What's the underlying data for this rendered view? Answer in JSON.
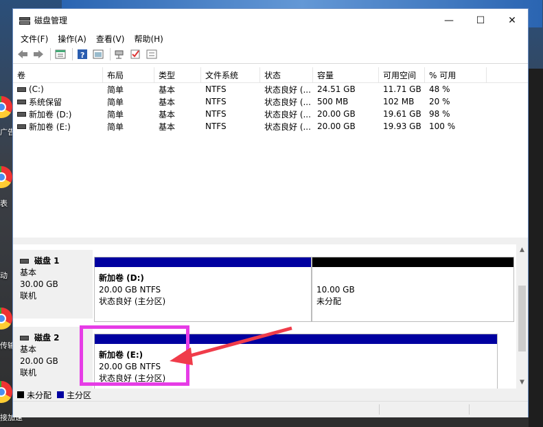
{
  "window": {
    "title": "磁盘管理",
    "controls": [
      "—",
      "☐",
      "✕"
    ]
  },
  "menu": [
    "文件(F)",
    "操作(A)",
    "查看(V)",
    "帮助(H)"
  ],
  "toolbar": [
    "back-icon",
    "forward-icon",
    "properties-icon",
    "help-icon",
    "view-icon",
    "connect-icon",
    "check-icon",
    "list-icon"
  ],
  "volumes": {
    "headers": [
      "卷",
      "布局",
      "类型",
      "文件系统",
      "状态",
      "容量",
      "可用空间",
      "% 可用"
    ],
    "rows": [
      [
        "(C:)",
        "简单",
        "基本",
        "NTFS",
        "状态良好 (...",
        "24.51 GB",
        "11.71 GB",
        "48 %"
      ],
      [
        "系统保留",
        "简单",
        "基本",
        "NTFS",
        "状态良好 (...",
        "500 MB",
        "102 MB",
        "20 %"
      ],
      [
        "新加卷 (D:)",
        "简单",
        "基本",
        "NTFS",
        "状态良好 (...",
        "20.00 GB",
        "19.61 GB",
        "98 %"
      ],
      [
        "新加卷 (E:)",
        "简单",
        "基本",
        "NTFS",
        "状态良好 (...",
        "20.00 GB",
        "19.93 GB",
        "100 %"
      ]
    ]
  },
  "disks": [
    {
      "name": "磁盘 1",
      "type": "基本",
      "size": "30.00 GB",
      "state": "联机",
      "partitions": [
        {
          "title": "新加卷 (D:)",
          "line1": "20.00 GB NTFS",
          "line2": "状态良好 (主分区)",
          "color": "#0000a0"
        },
        {
          "title": "",
          "line1": "10.00 GB",
          "line2": "未分配",
          "color": "#000000"
        }
      ]
    },
    {
      "name": "磁盘 2",
      "type": "基本",
      "size": "20.00 GB",
      "state": "联机",
      "partitions": [
        {
          "title": "新加卷 (E:)",
          "line1": "20.00 GB NTFS",
          "line2": "状态良好 (主分区)",
          "color": "#0000a0"
        }
      ]
    }
  ],
  "legend": [
    {
      "label": "未分配",
      "color": "#000000"
    },
    {
      "label": "主分区",
      "color": "#0000a0"
    }
  ],
  "desktop": {
    "labels": [
      "广告",
      "表",
      "动",
      "传输",
      "接加速"
    ]
  },
  "annotation": {
    "highlight_color": "#e63ce6",
    "arrow_color": "#f03c4a"
  }
}
